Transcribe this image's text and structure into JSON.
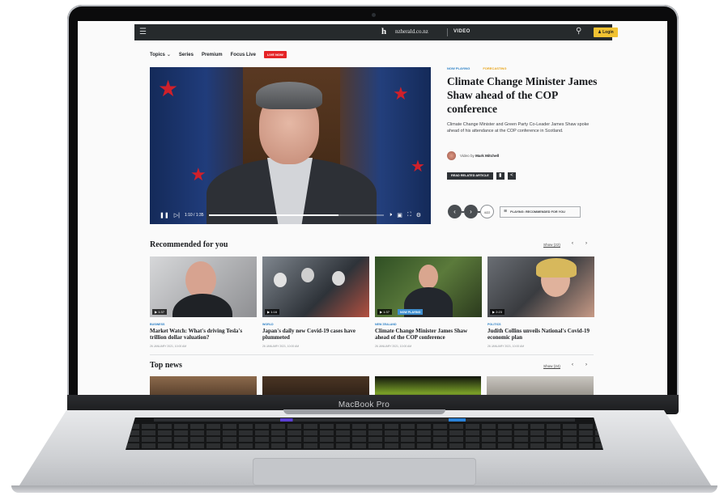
{
  "device": {
    "label": "MacBook Pro"
  },
  "topbar": {
    "site": "nzherald.co.nz",
    "section": "VIDEO",
    "login_label": "Login"
  },
  "nav": {
    "items": [
      "Topics",
      "Series",
      "Premium",
      "Focus Live"
    ],
    "live_badge": "LIVE NOW"
  },
  "player": {
    "time": "1:10 / 1:35",
    "progress_fraction": 0.74
  },
  "article": {
    "tag_primary": "NOW PLAYING",
    "tag_secondary": "FORECASTING",
    "headline": "Climate Change Minister James Shaw ahead of the COP conference",
    "summary": "Climate Change Minister and Green Party Co-Leader James Shaw spoke ahead of his attendance at the COP conference in Scotland.",
    "byline_prefix": "Video by",
    "byline_name": "Mark Mitchell",
    "read_related": "READ RELATED ARTICLE",
    "pager_count": "4/22",
    "playlist_label": "PLAYING: RECOMMENDED FOR YOU"
  },
  "recommended": {
    "title": "Recommended for you",
    "show_label": "Show (22)",
    "cards": [
      {
        "duration": "1:37",
        "category": "BUSINESS",
        "title": "Market Watch: What's driving Tesla's trillion dollar valuation?",
        "date": "26 JANUARY 2021, 10:00 AM",
        "now": ""
      },
      {
        "duration": "1:16",
        "category": "WORLD",
        "title": "Japan's daily new Covid-19 cases have plummeted",
        "date": "26 JANUARY 2021, 10:00 AM",
        "now": ""
      },
      {
        "duration": "1:37",
        "category": "NEW ZEALAND",
        "title": "Climate Change Minister James Shaw ahead of the COP conference",
        "date": "26 JANUARY 2021, 10:00 AM",
        "now": "NOW PLAYING"
      },
      {
        "duration": "2:23",
        "category": "POLITICS",
        "title": "Judith Collins unveils National's Covid-19 economic plan",
        "date": "26 JANUARY 2021, 10:00 AM",
        "now": ""
      }
    ]
  },
  "top_news": {
    "title": "Top news",
    "show_label": "Show (24)"
  },
  "colors": {
    "accent": "#f1c232",
    "live": "#e52326",
    "link_blue": "#2a7fc5",
    "topbar": "#262a2c"
  },
  "icons": [
    "menu-icon",
    "search-icon",
    "play-pause-icon",
    "skip-icon",
    "volume-icon",
    "captions-icon",
    "fullscreen-icon",
    "settings-icon",
    "bookmark-icon",
    "share-icon",
    "chevron-left-icon",
    "chevron-right-icon",
    "playlist-icon"
  ]
}
